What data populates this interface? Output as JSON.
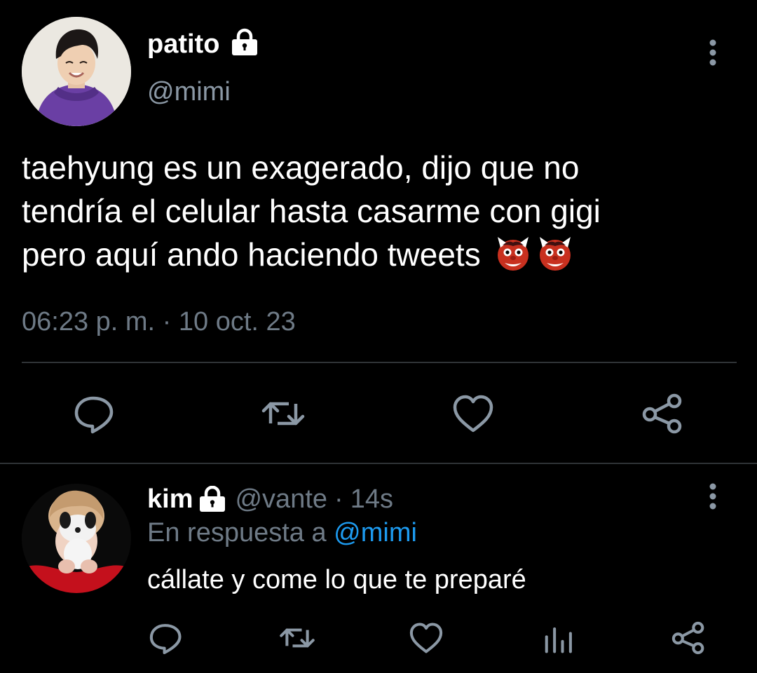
{
  "main_tweet": {
    "display_name": "patito",
    "handle": "@mimi",
    "text_lines": [
      "taehyung es un exagerado, dijo que no",
      "tendría el celular hasta casarme con gigi",
      "pero aquí ando haciendo tweets"
    ],
    "emoji": [
      "japanese-ogre",
      "japanese-ogre"
    ],
    "timestamp": "06:23 p. m. · 10 oct. 23",
    "actions": [
      "reply-icon",
      "retweet-icon",
      "like-icon",
      "share-icon"
    ]
  },
  "reply": {
    "display_name": "kim",
    "handle": "@vante",
    "separator": "·",
    "time": "14s",
    "replying_prefix": "En respuesta a",
    "replying_to": "@mimi",
    "text": "cállate y come lo que te preparé",
    "actions": [
      "reply-icon",
      "retweet-icon",
      "like-icon",
      "views-icon",
      "share-icon"
    ]
  },
  "colors": {
    "background": "#000000",
    "text_primary": "#ffffff",
    "text_secondary": "#6e7a86",
    "link": "#1d9bf0",
    "divider": "#2f3336"
  }
}
